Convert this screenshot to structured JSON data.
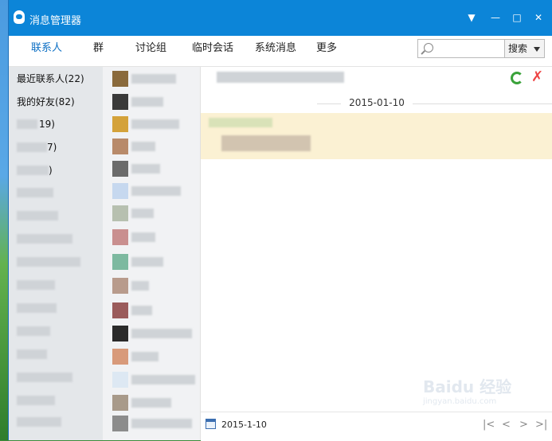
{
  "window": {
    "title": "消息管理器"
  },
  "titlebar": {
    "dropdown_icon": "▼",
    "minimize_icon": "—",
    "maximize_icon": "□",
    "close_icon": "✕"
  },
  "tabs": [
    {
      "label": "联系人",
      "active": true
    },
    {
      "label": "群",
      "active": false
    },
    {
      "label": "讨论组",
      "active": false
    },
    {
      "label": "临时会话",
      "active": false
    },
    {
      "label": "系统消息",
      "active": false
    },
    {
      "label": "更多",
      "active": false
    }
  ],
  "search": {
    "placeholder": "",
    "button_label": "搜索"
  },
  "groups": {
    "recent": "最近联系人(22)",
    "friends": "我的好友(82)",
    "g3": "19)",
    "g4": "7)",
    "g5": ")"
  },
  "chat": {
    "date_header": "2015-01-10"
  },
  "bottom": {
    "date": "2015-1-10"
  },
  "watermark": "Baidu 经验",
  "watermark_sub": "jingyan.baidu.com",
  "colors": {
    "accent": "#0c85d8",
    "tab_active": "#0c6fc4",
    "message_bg": "#fbf1d3"
  }
}
